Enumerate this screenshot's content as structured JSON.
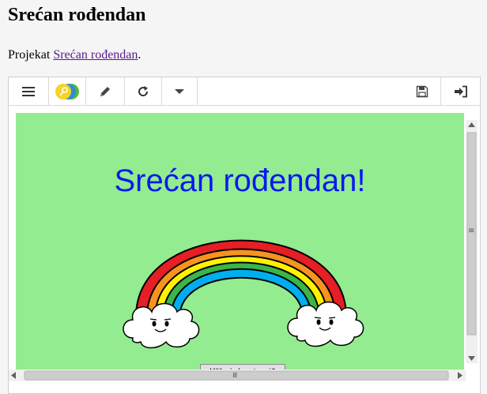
{
  "page": {
    "title": "Srećan rođendan",
    "intro_prefix": "Projekat ",
    "intro_link": "Srećan rođendan",
    "intro_suffix": "."
  },
  "toolbar": {
    "buttons": [
      {
        "name": "menu",
        "icon": "hamburger-icon"
      },
      {
        "name": "toggle",
        "icon": "toggle-icon"
      },
      {
        "name": "edit",
        "icon": "pencil-icon"
      },
      {
        "name": "restart",
        "icon": "refresh-icon"
      },
      {
        "name": "more",
        "icon": "caret-down-icon"
      },
      {
        "name": "save",
        "icon": "floppy-icon"
      },
      {
        "name": "sign-in",
        "icon": "sign-in-icon"
      }
    ],
    "colors": {
      "icon": "#333333",
      "toggle_yellow": "#f5d327",
      "toggle_blue": "#2b8fd6",
      "toggle_green": "#5ab53e"
    }
  },
  "stage": {
    "greeting": "Srećan rođendan!",
    "button_label": "Klikni da otvoriš",
    "background": "#93ec8f",
    "greeting_color": "#0a18f0"
  },
  "scrollbars": {
    "vertical_grip": "≡",
    "horizontal_grip": "≡"
  }
}
